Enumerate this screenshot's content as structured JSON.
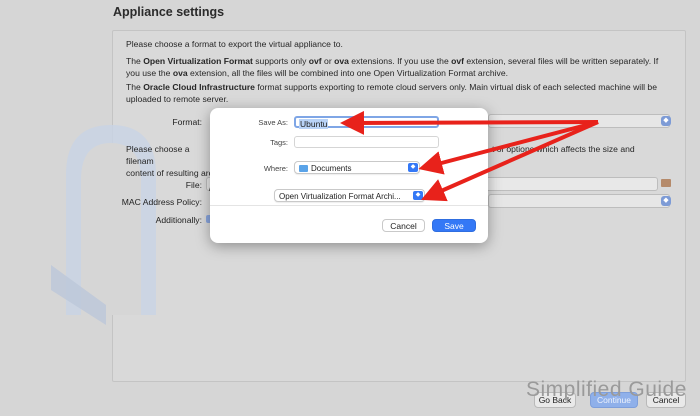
{
  "header": {
    "title": "Appliance settings"
  },
  "panel": {
    "intro": "Please choose a format to export the virtual appliance to.",
    "ovf_desc": {
      "p1": "The ",
      "b1": "Open Virtualization Format",
      "p2": " supports only ",
      "b2": "ovf",
      "p3": " or ",
      "b3": "ova",
      "p4": " extensions. If you use the ",
      "b4": "ovf",
      "p5": " extension, several files will be written separately. If you use the ",
      "b5": "ova",
      "p6": " extension, all the files will be combined into one Open Virtualization Format archive."
    },
    "oci_desc": {
      "p1": "The ",
      "b1": "Oracle Cloud Infrastructure",
      "p2": " format supports exporting to remote cloud servers only. Main virtual disk of each selected machine will be uploaded to remote server."
    },
    "format_label": "Format:",
    "filename_desc_left_1": "Please choose a filenam",
    "filename_desc_left_2": "content of resulting arc",
    "filename_desc_right": "t of options which affects the size and",
    "file_label": "File:",
    "file_value": "/",
    "mac_label": "MAC Address Policy:",
    "additionally_label": "Additionally:"
  },
  "bottom": {
    "go_back": "Go Back",
    "continue": "Continue",
    "cancel": "Cancel"
  },
  "watermark": "Simplified Guide",
  "dialog": {
    "save_as_label": "Save As:",
    "save_as_value": "Ubuntu",
    "tags_label": "Tags:",
    "where_label": "Where:",
    "where_value": "Documents",
    "format_value": "Open Virtualization Format Archi...",
    "cancel_label": "Cancel",
    "save_label": "Save"
  },
  "colors": {
    "accent": "#3478f6",
    "arrow": "#e8221b"
  }
}
